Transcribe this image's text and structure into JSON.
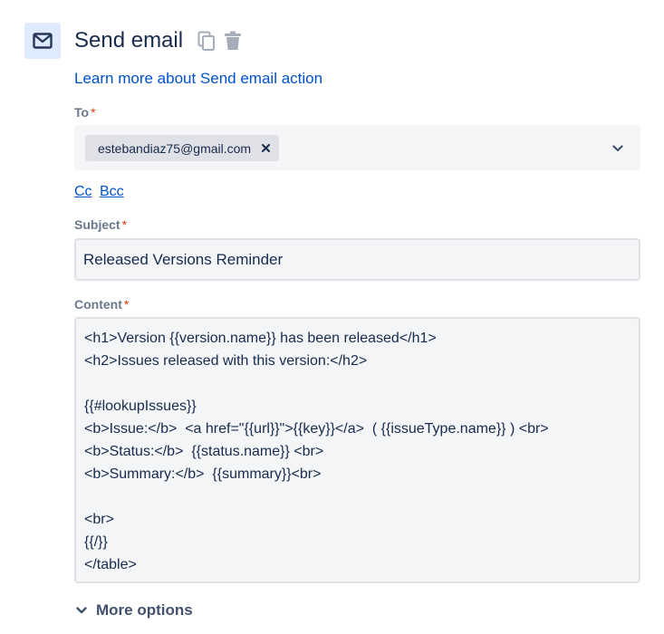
{
  "header": {
    "title": "Send email",
    "icon": "mail-icon",
    "accent": "#deebff"
  },
  "learn_more_link": "Learn more about Send email action",
  "to": {
    "label": "To",
    "required_mark": "*",
    "recipients": [
      "estebandiaz75@gmail.com"
    ]
  },
  "cc_label": "Cc",
  "bcc_label": "Bcc",
  "subject": {
    "label": "Subject",
    "required_mark": "*",
    "value": "Released Versions Reminder"
  },
  "content": {
    "label": "Content",
    "required_mark": "*",
    "value": "<h1>Version {{version.name}} has been released</h1>\n<h2>Issues released with this version:</h2>\n\n{{#lookupIssues}}\n<b>Issue:</b>  <a href=\"{{url}}\">{{key}}</a>  ( {{issueType.name}} ) <br>\n<b>Status:</b>  {{status.name}} <br>\n<b>Summary:</b>  {{summary}}<br>\n\n<br>\n{{/}}\n</table>"
  },
  "more_options_label": "More options",
  "colors": {
    "link": "#0052cc",
    "required": "#de350b",
    "field_bg": "#f4f5f7"
  }
}
